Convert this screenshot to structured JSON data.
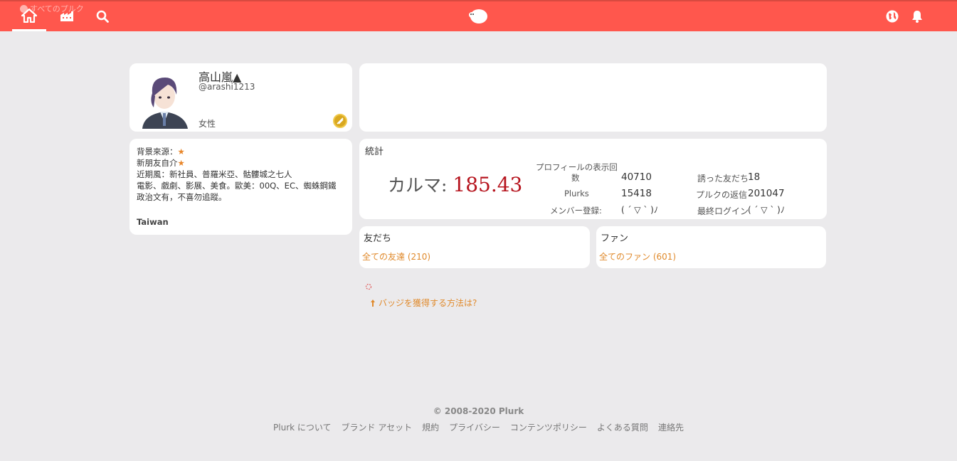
{
  "nav": {
    "all_plurks_label": "すべてのプルク",
    "colors": {
      "bar": "#ff574d",
      "accent_link": "#e08a2c",
      "karma": "#b6141e"
    }
  },
  "profile": {
    "display_name": "高山嵐▲",
    "nick_name": "@arashi1213",
    "gender": "女性"
  },
  "about": {
    "lines": [
      {
        "text": "背景來源：",
        "star": "★"
      },
      {
        "text": "新朋友自介",
        "star": "★"
      },
      {
        "text": "近期風：新社員、普羅米亞、骷髏城之七人",
        "star": ""
      },
      {
        "text": "電影、戲劇、影展、美食。歐美：00Q、EC、蜘蛛鋼鐵",
        "star": ""
      },
      {
        "text": "政治文有，不喜勿追蹤。",
        "star": ""
      }
    ],
    "location": "Taiwan"
  },
  "stats": {
    "title": "統計",
    "karma_label": "カルマ:",
    "karma_value": "185.43",
    "profile_views_label_1": "プロフィールの表示回",
    "profile_views_label_2": "数",
    "profile_views_value": "40710",
    "plurks_label": "Plurks",
    "plurks_value": "15418",
    "member_since_label": "メンバー登録:",
    "member_since_value": "( ´ ▽ ` )ﾉ",
    "invited_label": "誘った友だち",
    "invited_value": "18",
    "responses_label": "プルクの返信",
    "responses_value": "201047",
    "last_login_label": "最終ログイン",
    "last_login_value": "( ´ ▽ ` )ﾉ"
  },
  "friends": {
    "title": "友だち",
    "link": "全ての友達 (210)"
  },
  "fans": {
    "title": "ファン",
    "link": "全てのファン (601)"
  },
  "badge_link": "バッジを獲得する方法は?",
  "footer": {
    "copyright": "© 2008-2020 Plurk",
    "links": [
      "Plurk について",
      "ブランド アセット",
      "規約",
      "プライバシー",
      "コンテンツポリシー",
      "よくある質問",
      "連絡先"
    ]
  }
}
